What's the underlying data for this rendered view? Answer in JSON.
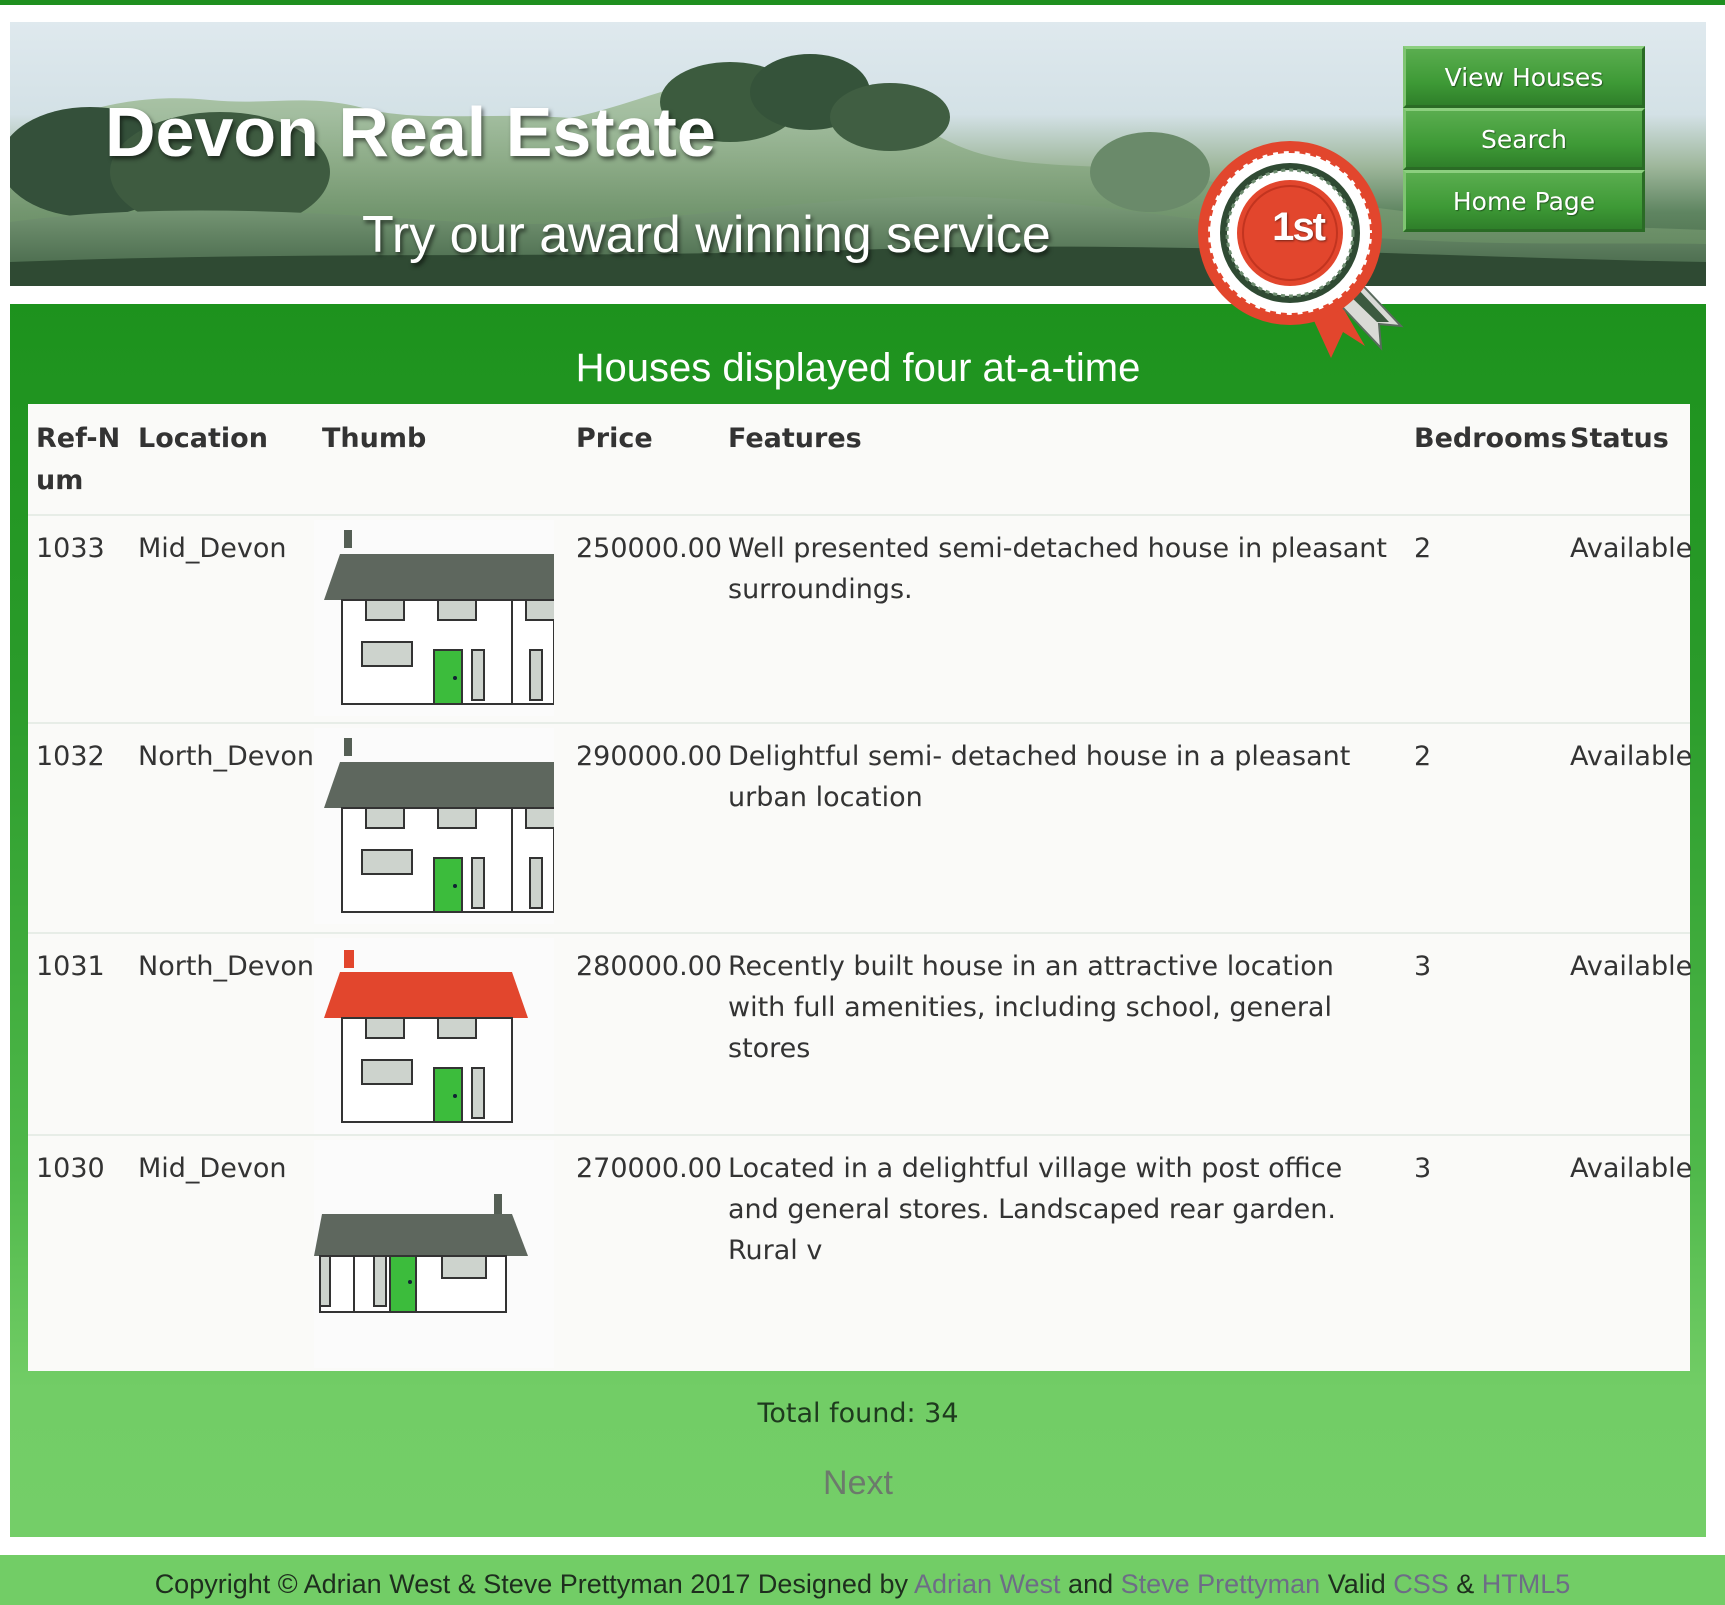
{
  "header": {
    "site_title": "Devon Real Estate",
    "tagline": "Try our award winning service",
    "rosette_text": "1st"
  },
  "nav": {
    "items": [
      {
        "label": "View Houses"
      },
      {
        "label": "Search"
      },
      {
        "label": "Home Page"
      }
    ]
  },
  "main": {
    "heading": "Houses displayed four at-a-time",
    "table": {
      "columns": [
        "Ref-Num",
        "Location",
        "Thumb",
        "Price",
        "Features",
        "Bedrooms",
        "Status"
      ],
      "rows": [
        {
          "ref": "1033",
          "location": "Mid_Devon",
          "thumb": "two-storey-house-grey-roof-cropped",
          "price": "250000.00",
          "features": "Well presented semi-detached house in pleasant surroundings.",
          "bedrooms": "2",
          "status": "Available"
        },
        {
          "ref": "1032",
          "location": "North_Devon",
          "thumb": "two-storey-house-grey-roof-cropped",
          "price": "290000.00",
          "features": "Delightful semi- detached house in a pleasant urban location",
          "bedrooms": "2",
          "status": "Available"
        },
        {
          "ref": "1031",
          "location": "North_Devon",
          "thumb": "two-storey-house-red-roof",
          "price": "280000.00",
          "features": "Recently built house in an attractive location with full amenities, including school, general stores",
          "bedrooms": "3",
          "status": "Available"
        },
        {
          "ref": "1030",
          "location": "Mid_Devon",
          "thumb": "bungalow-grey-roof",
          "price": "270000.00",
          "features": "Located in a delightful village with post office and general stores. Landscaped rear garden. Rural v",
          "bedrooms": "3",
          "status": "Available"
        }
      ]
    },
    "total_found": "Total found: 34",
    "next_label": "Next"
  },
  "footer": {
    "prefix": "Copyright © Adrian West & Steve Prettyman 2017 Designed by ",
    "author1": "Adrian West",
    "and": " and ",
    "author2": "Steve Prettyman",
    "valid": " Valid ",
    "css": "CSS",
    "amp": " & ",
    "html5": "HTML5"
  },
  "colors": {
    "brand_green": "#1d921d",
    "light_green": "#72cd66",
    "rosette_red": "#e2462d",
    "door_green": "#3cbc3c"
  }
}
